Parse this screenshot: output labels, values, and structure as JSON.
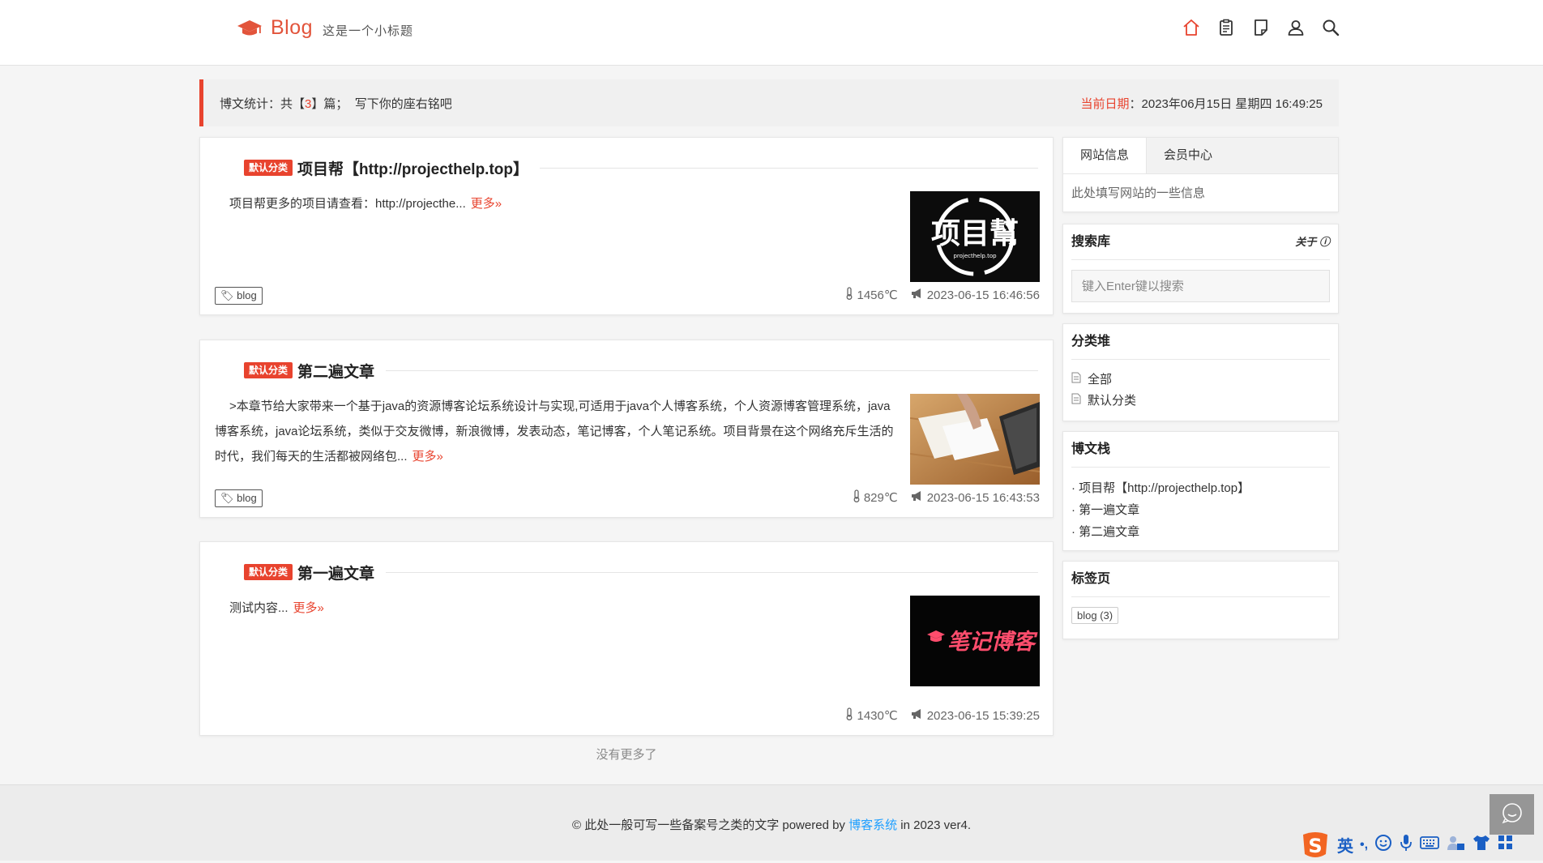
{
  "header": {
    "logo_text": "Blog",
    "subtitle": "这是一个小标题",
    "nav_icons": [
      "home-icon",
      "clipboard-icon",
      "note-icon",
      "user-icon",
      "search-icon"
    ],
    "accent_color": "#e2543b"
  },
  "statbar": {
    "prefix": "博文统计：共【",
    "count": "3",
    "suffix": "】篇；  写下你的座右铭吧",
    "date_label": "当前日期",
    "date_value": "：2023年06月15日 星期四 16:49:25"
  },
  "posts": [
    {
      "category": "默认分类",
      "title": "项目帮【http://projecthelp.top】",
      "excerpt": "项目帮更多的项目请查看：http://projecthe...",
      "more": "更多»",
      "tag": "blog",
      "views": "1456℃",
      "date": "2023-06-15 16:46:56",
      "thumb_text": "项目幫",
      "thumb_sub": "projecthelp.top"
    },
    {
      "category": "默认分类",
      "title": "第二遍文章",
      "excerpt": ">本章节给大家带来一个基于java的资源博客论坛系统设计与实现,可适用于java个人博客系统，个人资源博客管理系统，java博客系统，java论坛系统，类似于交友微博，新浪微博，发表动态，笔记博客，个人笔记系统。项目背景在这个网络充斥生活的时代，我们每天的生活都被网络包...",
      "more": "更多»",
      "tag": "blog",
      "views": "829℃",
      "date": "2023-06-15 16:43:53"
    },
    {
      "category": "默认分类",
      "title": "第一遍文章",
      "excerpt": "测试内容...",
      "more": "更多»",
      "views": "1430℃",
      "date": "2023-06-15 15:39:25",
      "thumb_text": "笔记博客"
    }
  ],
  "no_more": "没有更多了",
  "sidebar": {
    "tabs": [
      "网站信息",
      "会员中心"
    ],
    "site_info": "此处填写网站的一些信息",
    "search": {
      "title": "搜索库",
      "about": "关于",
      "placeholder": "键入Enter键以搜索"
    },
    "categories": {
      "title": "分类堆",
      "items": [
        "全部",
        "默认分类"
      ]
    },
    "posts": {
      "title": "博文栈",
      "items": [
        "项目帮【http://projecthelp.top】",
        "第一遍文章",
        "第二遍文章"
      ]
    },
    "tags": {
      "title": "标签页",
      "items": [
        "blog (3)"
      ]
    }
  },
  "footer": {
    "prefix": "© 此处一般可写一些备案号之类的文字 powered by ",
    "link": "博客系统",
    "suffix": " in 2023 ver4."
  },
  "ime": {
    "lang": "英",
    "punct": "•,"
  }
}
